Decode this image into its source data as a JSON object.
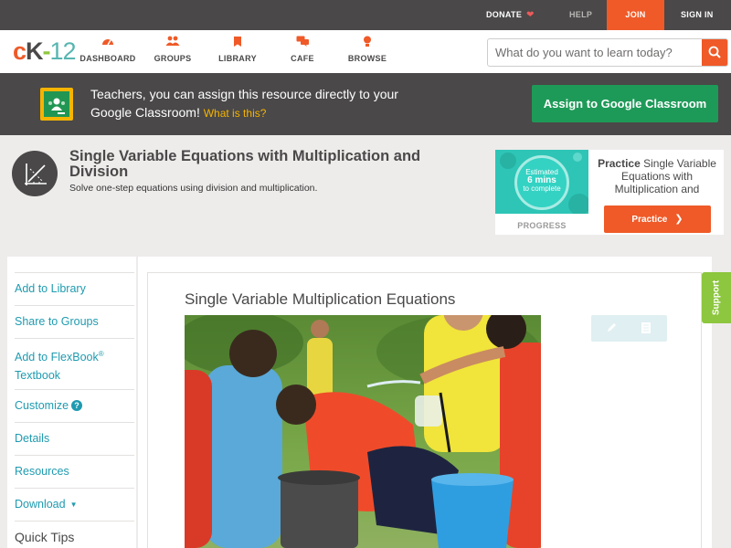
{
  "topbar": {
    "donate": "DONATE",
    "help": "HELP",
    "join": "JOIN",
    "signin": "SIGN IN"
  },
  "nav": {
    "logo": {
      "c": "c",
      "k": "K",
      "dash": "-",
      "num": "12"
    },
    "items": [
      {
        "label": "DASHBOARD",
        "icon": "dashboard-icon"
      },
      {
        "label": "GROUPS",
        "icon": "groups-icon"
      },
      {
        "label": "LIBRARY",
        "icon": "library-icon"
      },
      {
        "label": "CAFE",
        "icon": "cafe-icon"
      },
      {
        "label": "BROWSE",
        "icon": "browse-icon"
      }
    ],
    "search_placeholder": "What do you want to learn today?"
  },
  "banner": {
    "text": "Teachers, you can assign this resource directly to your Google Classroom!",
    "what": "What is this?",
    "button": "Assign to Google Classroom"
  },
  "concept": {
    "title": "Single Variable Equations with Multiplication and Division",
    "subtitle": "Solve one-step equations using division and multiplication."
  },
  "practice": {
    "estimated": "Estimated",
    "mins": "6 mins",
    "complete": "to complete",
    "progress_label": "PROGRESS",
    "bold": "Practice",
    "text": "Single Variable Equations with Multiplication and",
    "button": "Practice"
  },
  "sidebar": {
    "items": [
      "Add to Library",
      "Share to Groups",
      "Customize",
      "Details",
      "Resources",
      "Download",
      "Quick Tips"
    ],
    "flexbook_1": "Add to FlexBook",
    "flexbook_sup": "®",
    "flexbook_2": "Textbook"
  },
  "content": {
    "title": "Single Variable Multiplication Equations"
  },
  "support": "Support",
  "colors": {
    "brand_orange": "#ef5a28",
    "dark_bar": "#4a4848",
    "link_teal": "#1f9bb0",
    "google_green": "#1e9a58",
    "support_green": "#8dc63f"
  }
}
